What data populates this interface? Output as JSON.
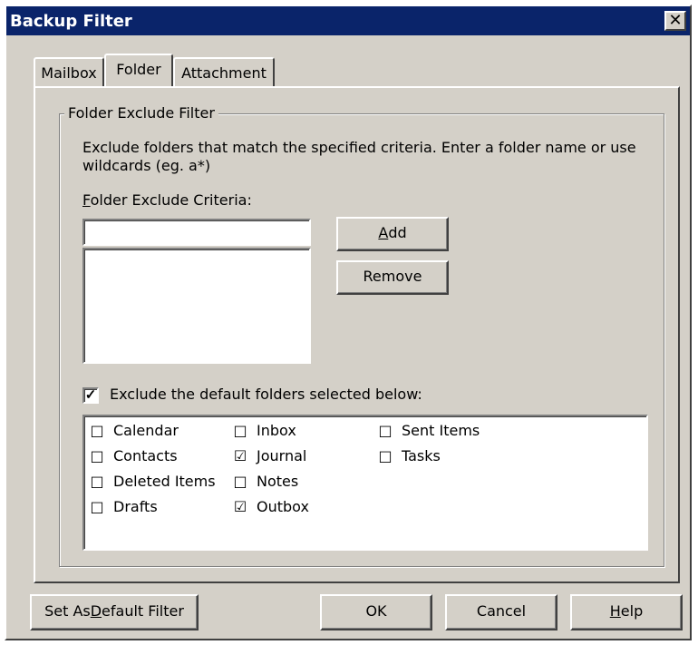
{
  "window": {
    "title": "Backup Filter"
  },
  "tabs": [
    {
      "label": "Mailbox"
    },
    {
      "label": "Folder"
    },
    {
      "label": "Attachment"
    }
  ],
  "group": {
    "title": "Folder Exclude Filter",
    "description_line1": "Exclude folders that match the specified criteria.  Enter a folder name or use",
    "description_line2": "wildcards (eg. a*)",
    "criteria_label_first": "F",
    "criteria_label_rest": "older Exclude Criteria:",
    "criteria_value": "",
    "add_first": "A",
    "add_rest": "dd",
    "remove_label": "Remove",
    "exclude_default_checked": "✓",
    "exclude_default_label": "Exclude the default folders selected below:"
  },
  "folders": [
    {
      "label": "Calendar",
      "mark": "□"
    },
    {
      "label": "Contacts",
      "mark": "□"
    },
    {
      "label": "Deleted Items",
      "mark": "□"
    },
    {
      "label": "Drafts",
      "mark": "□"
    },
    {
      "label": "Inbox",
      "mark": "□"
    },
    {
      "label": "Journal",
      "mark": "☑"
    },
    {
      "label": "Notes",
      "mark": "□"
    },
    {
      "label": "Outbox",
      "mark": "☑"
    },
    {
      "label": "Sent Items",
      "mark": "□"
    },
    {
      "label": "Tasks",
      "mark": "□"
    }
  ],
  "footer": {
    "default_pre": "Set As ",
    "default_u": "D",
    "default_post": "efault Filter",
    "ok": "OK",
    "cancel": "Cancel",
    "help_u": "H",
    "help_rest": "elp"
  },
  "icons": {
    "close": "close-icon"
  }
}
